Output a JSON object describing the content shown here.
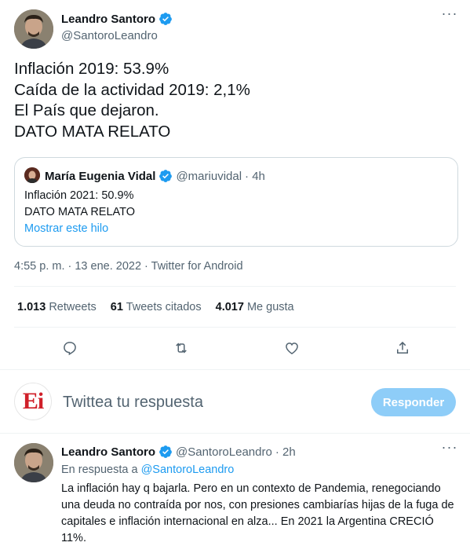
{
  "main_tweet": {
    "author_name": "Leandro Santoro",
    "author_handle": "@SantoroLeandro",
    "lines": [
      "Inflación 2019: 53.9%",
      "Caída de la actividad 2019: 2,1%",
      "El País que dejaron.",
      "DATO MATA RELATO"
    ],
    "quote": {
      "author_name": "María Eugenia Vidal",
      "author_handle": "@mariuvidal",
      "time": "· 4h",
      "lines": [
        "Inflación 2021: 50.9%",
        "DATO MATA RELATO"
      ],
      "show_thread": "Mostrar este hilo"
    },
    "meta": "4:55 p. m. · 13 ene. 2022 · Twitter for Android",
    "stats": [
      {
        "count": "1.013",
        "label": "Retweets"
      },
      {
        "count": "61",
        "label": "Tweets citados"
      },
      {
        "count": "4.017",
        "label": "Me gusta"
      }
    ],
    "actions": [
      "reply-icon",
      "retweet-icon",
      "like-icon",
      "share-icon"
    ]
  },
  "reply_compose": {
    "logo_text": "Ei",
    "placeholder": "Twittea tu respuesta",
    "button_label": "Responder"
  },
  "reply_tweet": {
    "author_name": "Leandro Santoro",
    "author_handle": "@SantoroLeandro",
    "time": "· 2h",
    "in_reply_prefix": "En respuesta a",
    "in_reply_mention": "@SantoroLeandro",
    "text": "La inflación hay q bajarla. Pero en un contexto de Pandemia, renegociando una deuda no contraída por nos, con presiones cambiarías hijas de la fuga de capitales e inflación internacional en alza... En 2021 la Argentina CRECIÓ 11%."
  },
  "colors": {
    "accent": "#1d9bf0",
    "button_disabled": "#8ecdf8",
    "secondary_text": "#536471",
    "border": "#cfd9de"
  }
}
